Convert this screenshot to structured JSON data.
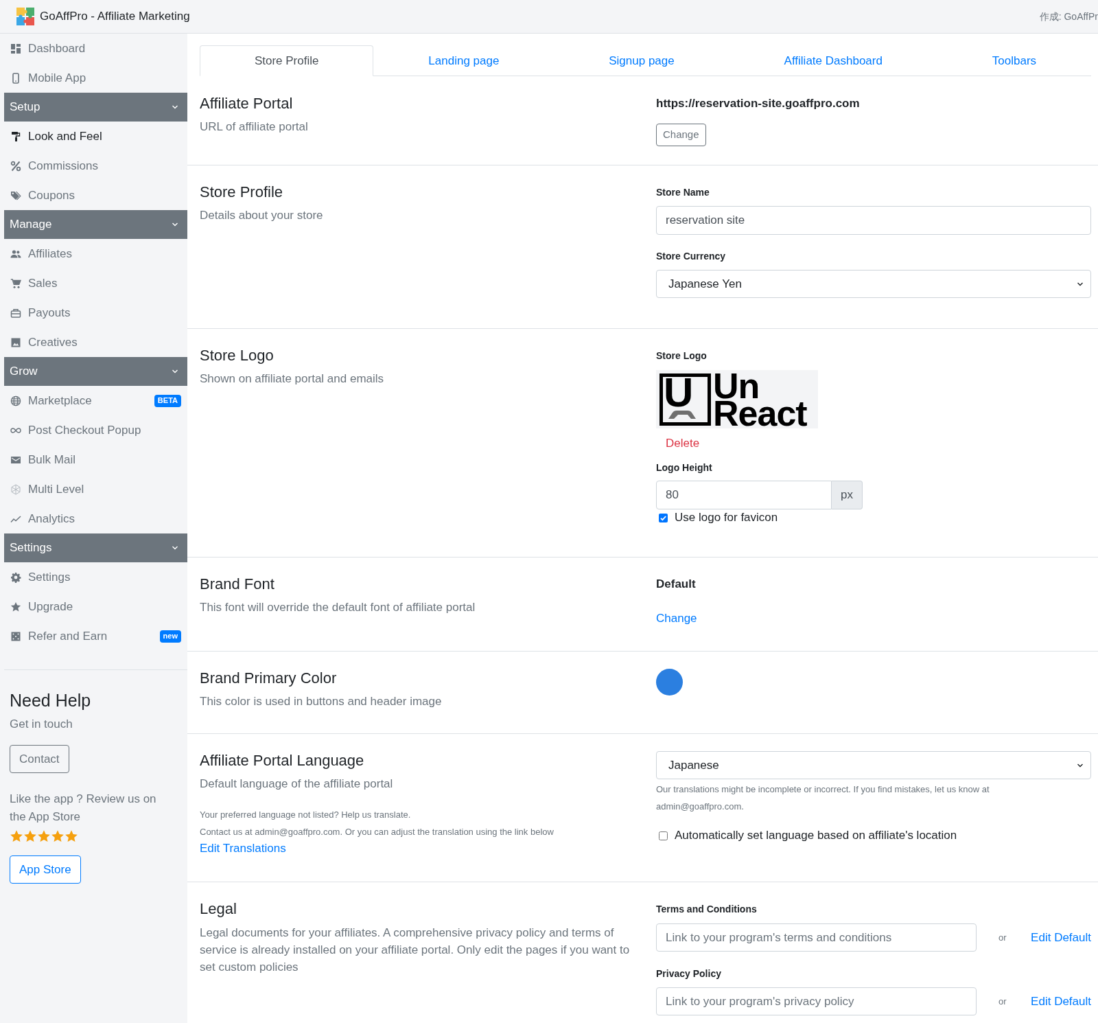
{
  "header": {
    "title": "GoAffPro - Affiliate Marketing",
    "credit": "作成: GoAffPr"
  },
  "sidebar": {
    "items": [
      {
        "label": "Dashboard",
        "selected": false
      },
      {
        "label": "Mobile App",
        "selected": false
      }
    ],
    "sections": [
      {
        "title": "Setup",
        "expanded": true,
        "items": [
          {
            "label": "Look and Feel",
            "selected": true
          },
          {
            "label": "Commissions",
            "selected": false
          },
          {
            "label": "Coupons",
            "selected": false
          }
        ]
      },
      {
        "title": "Manage",
        "expanded": true,
        "items": [
          {
            "label": "Affiliates",
            "selected": false
          },
          {
            "label": "Sales",
            "selected": false
          },
          {
            "label": "Payouts",
            "selected": false
          },
          {
            "label": "Creatives",
            "selected": false
          }
        ]
      },
      {
        "title": "Grow",
        "expanded": true,
        "items": [
          {
            "label": "Marketplace",
            "selected": false,
            "badge": "BETA"
          },
          {
            "label": "Post Checkout Popup",
            "selected": false
          },
          {
            "label": "Bulk Mail",
            "selected": false
          },
          {
            "label": "Multi Level",
            "selected": false
          },
          {
            "label": "Analytics",
            "selected": false
          }
        ]
      },
      {
        "title": "Settings",
        "expanded": true,
        "items": [
          {
            "label": "Settings",
            "selected": false
          },
          {
            "label": "Upgrade",
            "selected": false
          },
          {
            "label": "Refer and Earn",
            "selected": false,
            "badge": "new"
          }
        ]
      }
    ]
  },
  "help": {
    "title": "Need Help",
    "subtitle": "Get in touch",
    "contact_button": "Contact",
    "review_text": "Like the app ? Review us on the App Store",
    "stars": 5,
    "app_store_button": "App Store"
  },
  "tabs": [
    {
      "label": "Store Profile",
      "selected": true
    },
    {
      "label": "Landing page",
      "selected": false
    },
    {
      "label": "Signup page",
      "selected": false
    },
    {
      "label": "Affiliate Dashboard",
      "selected": false
    },
    {
      "label": "Toolbars",
      "selected": false
    }
  ],
  "affiliate_portal": {
    "title": "Affiliate Portal",
    "subtitle": "URL of affiliate portal",
    "url": "https://reservation-site.goaffpro.com",
    "button": "Change"
  },
  "store_profile": {
    "title": "Store Profile",
    "subtitle": "Details about your store",
    "fields": [
      {
        "kind": "text",
        "label": "Store Name",
        "value": "reservation site"
      },
      {
        "kind": "select",
        "label": "Store Currency",
        "value": "Japanese Yen"
      }
    ]
  },
  "store_logo": {
    "title": "Store Logo",
    "subtitle": "Shown on affiliate portal and emails",
    "label": "Store Logo",
    "logo": {
      "mark": "U",
      "words": [
        "Un",
        "React"
      ]
    },
    "delete_link": "Delete",
    "height_label": "Logo Height",
    "height_value": "80",
    "height_unit": "px",
    "favicon": {
      "label": "Use logo for favicon",
      "checked": true
    }
  },
  "brand_font": {
    "title": "Brand Font",
    "subtitle": "This font will override the default font of affiliate portal",
    "value": "Default",
    "link": "Change"
  },
  "brand_color": {
    "title": "Brand Primary Color",
    "subtitle": "This color is used in buttons and header image",
    "color": "#2b7fe0"
  },
  "language": {
    "title": "Affiliate Portal Language",
    "subtitle": "Default language of the affiliate portal",
    "help_lines": [
      "Your preferred language not listed? Help us translate.",
      "Contact us at admin@goaffpro.com. Or you can adjust the translation using the link below"
    ],
    "link": "Edit Translations",
    "value": "Japanese",
    "note": "Our translations might be incomplete or incorrect. If you find mistakes, let us know at admin@goaffpro.com.",
    "auto_location": {
      "label": "Automatically set language based on affiliate's location",
      "checked": false
    }
  },
  "legal": {
    "title": "Legal",
    "description": "Legal documents for your affiliates. A comprehensive privacy policy and terms of service is already installed on your affiliate portal. Only edit the pages if you want to set custom policies",
    "fields": [
      {
        "label": "Terms and Conditions",
        "placeholder": "Link to your program's terms and conditions",
        "separator": "or",
        "link": "Edit Default"
      },
      {
        "label": "Privacy Policy",
        "placeholder": "Link to your program's privacy policy",
        "separator": "or",
        "link": "Edit Default"
      }
    ]
  }
}
